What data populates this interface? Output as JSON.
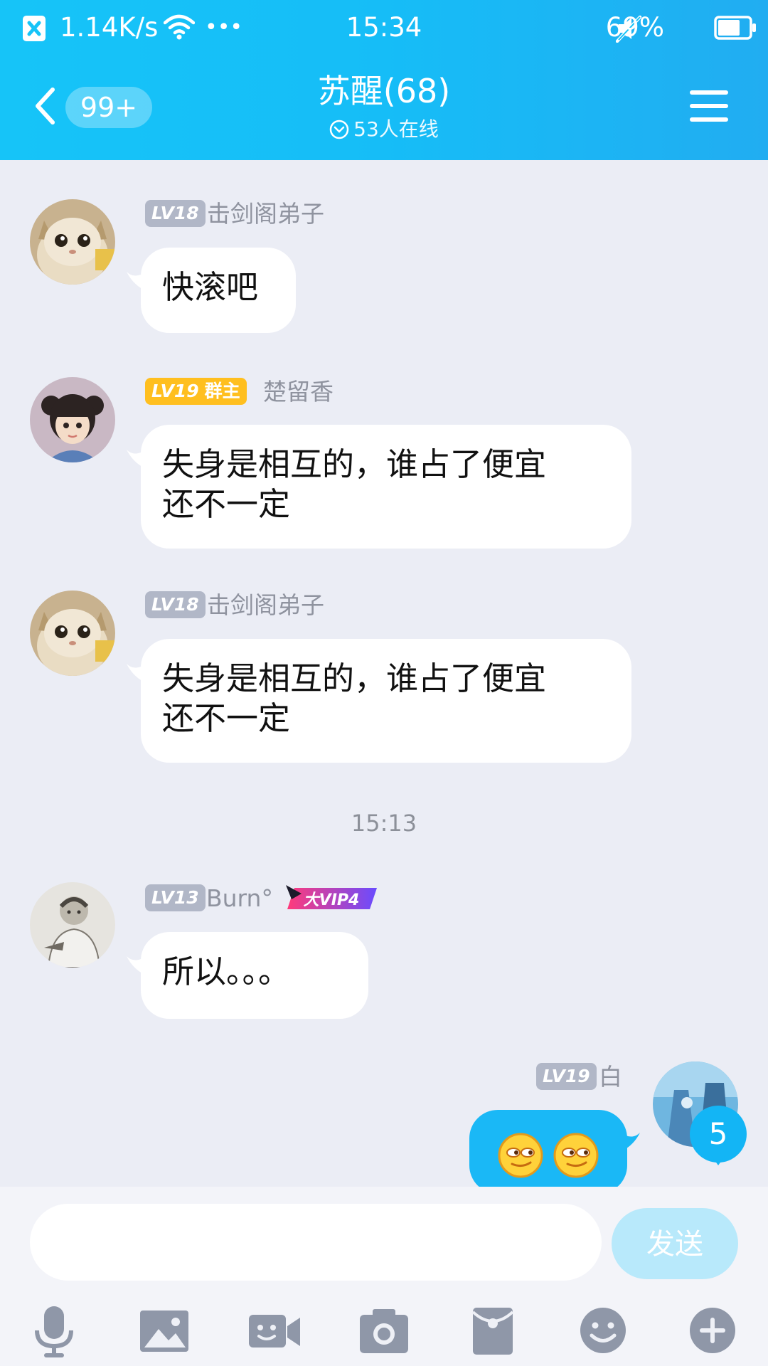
{
  "status_bar": {
    "net_speed": "1.14K/s",
    "more": "•••",
    "time": "15:34",
    "battery": "69%"
  },
  "header": {
    "back_badge": "99+",
    "title": "苏醒(68)",
    "subtitle": "53人在线"
  },
  "messages": [
    {
      "level": "LV18",
      "name": "击剑阁弟子",
      "text": "快滚吧"
    },
    {
      "level": "LV19",
      "role": "群主",
      "name": "楚留香",
      "text_line1": "失身是相互的，谁占了便宜",
      "text_line2": "还不一定"
    },
    {
      "level": "LV18",
      "name": "击剑阁弟子",
      "text_line1": "失身是相互的，谁占了便宜",
      "text_line2": "还不一定"
    },
    {
      "level": "LV13",
      "name": "Burn°",
      "vip": "大VIP4",
      "text": "所以。。。"
    }
  ],
  "timestamp": "15:13",
  "mine": {
    "level": "LV19",
    "name": "白",
    "unread": "5"
  },
  "input": {
    "placeholder": "",
    "send_label": "发送"
  },
  "toolbar_icons": [
    "microphone-icon",
    "image-icon",
    "video-call-icon",
    "camera-icon",
    "red-packet-icon",
    "emoji-icon",
    "plus-icon"
  ],
  "colors": {
    "header": "#16c4f8",
    "my_bubble": "#1ab8f6",
    "owner_badge": "#ffbf1f",
    "level_badge": "#b1b7c7"
  }
}
